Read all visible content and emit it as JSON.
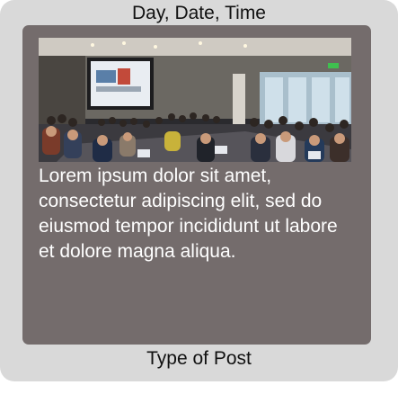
{
  "post": {
    "date_time": "Day, Date, Time",
    "body": "Lorem ipsum dolor sit amet, consectetur adipiscing elit, sed do eiusmod tempor incididunt ut labore et dolore magna aliqua.",
    "type": "Type of Post",
    "photo_icon": "conference-room-photo"
  },
  "colors": {
    "card_background": "#d9d9d9",
    "panel_background": "#746c6c",
    "body_text": "#ffffff",
    "label_text": "#111111"
  }
}
